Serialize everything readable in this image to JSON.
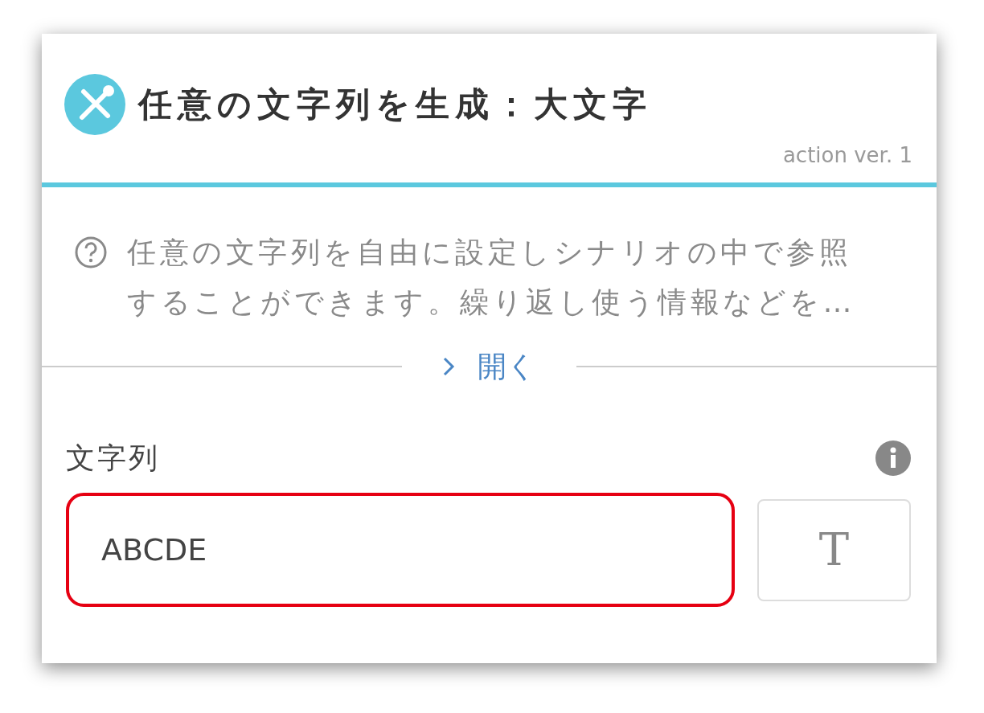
{
  "header": {
    "title": "任意の文字列を生成：大文字",
    "version": "action ver. 1"
  },
  "description": {
    "text": "任意の文字列を自由に設定しシナリオの中で参照することができます。繰り返し使う情報などを…"
  },
  "expand": {
    "label": "開く",
    "expanded": false
  },
  "field": {
    "label": "文字列",
    "value": "ABCDE",
    "highlighted": true
  },
  "type_button": {
    "label": "T"
  }
}
